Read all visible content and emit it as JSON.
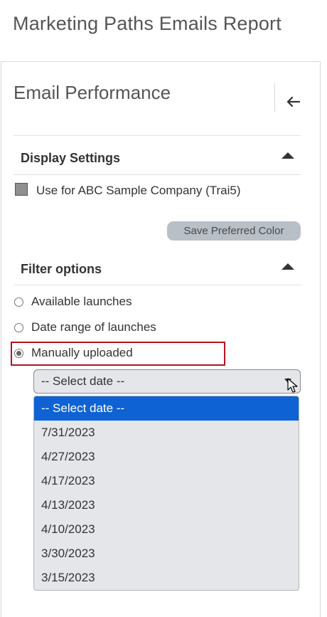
{
  "page": {
    "title": "Marketing Paths Emails Report"
  },
  "panel": {
    "title": "Email Performance",
    "back_icon": "arrow-left-icon"
  },
  "display_settings": {
    "heading": "Display Settings",
    "toggle_icon": "caret-up-icon",
    "use_for_label": "Use for ABC Sample Company (Trai5)",
    "swatch_color": "#8f8f8f",
    "save_button": "Save Preferred Color"
  },
  "filter_options": {
    "heading": "Filter options",
    "toggle_icon": "caret-up-icon",
    "radios": [
      {
        "label": "Available launches",
        "checked": false
      },
      {
        "label": "Date range of launches",
        "checked": false
      },
      {
        "label": "Manually uploaded",
        "checked": true
      }
    ],
    "select": {
      "value": "-- Select date --",
      "options": [
        "-- Select date --",
        "7/31/2023",
        "4/27/2023",
        "4/17/2023",
        "4/13/2023",
        "4/10/2023",
        "3/30/2023",
        "3/15/2023"
      ],
      "selected_index": 0
    }
  },
  "colors": {
    "accent": "#0e62d4",
    "highlight": "#b3141d",
    "button_bg": "#b9bfc7"
  }
}
